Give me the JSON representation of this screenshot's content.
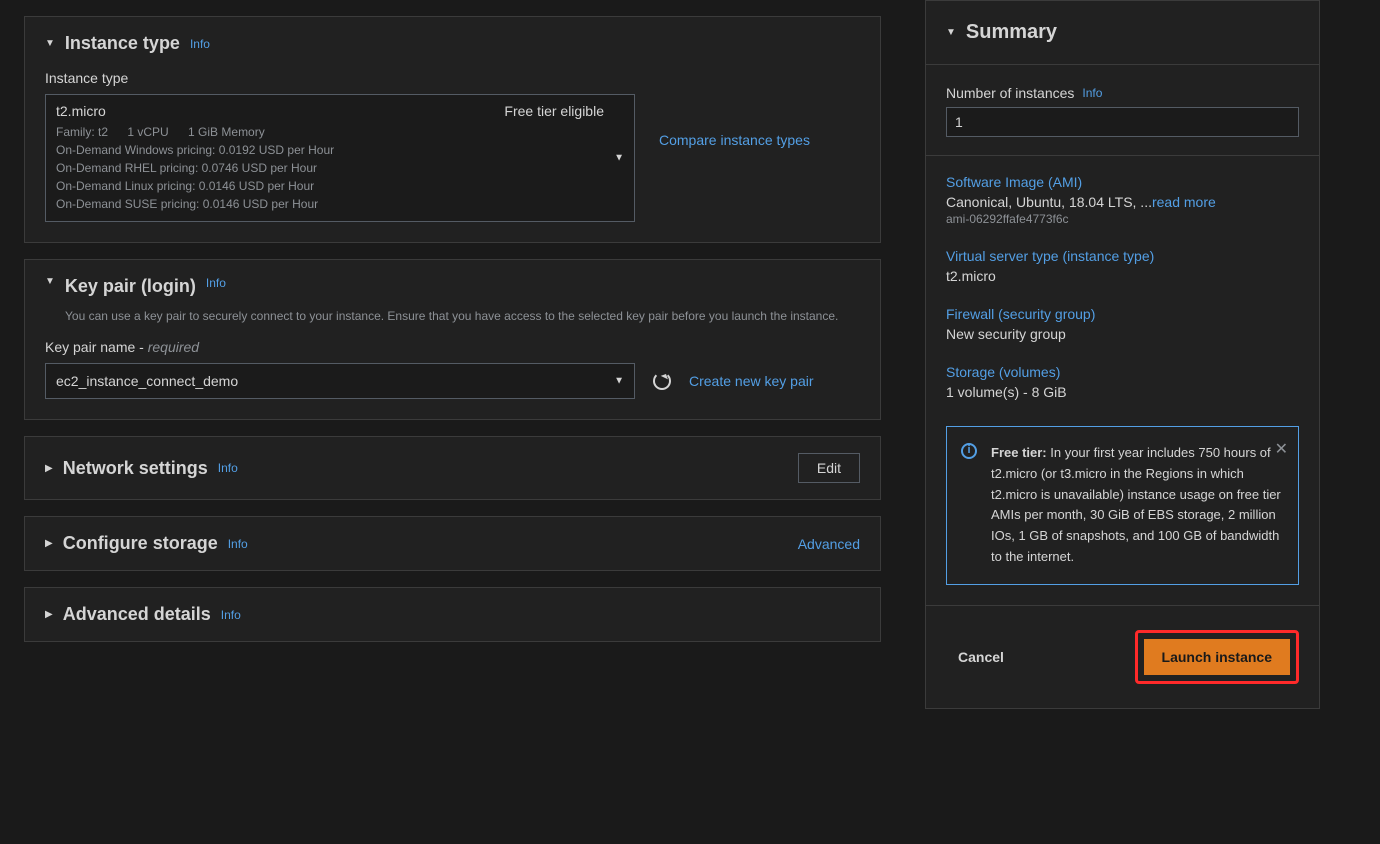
{
  "info_label": "Info",
  "instance_type": {
    "section_title": "Instance type",
    "field_label": "Instance type",
    "selected_name": "t2.micro",
    "free_tier_badge": "Free tier eligible",
    "family": "Family: t2",
    "vcpu": "1 vCPU",
    "memory": "1 GiB Memory",
    "pricing_windows": "On-Demand Windows pricing: 0.0192 USD per Hour",
    "pricing_rhel": "On-Demand RHEL pricing: 0.0746 USD per Hour",
    "pricing_linux": "On-Demand Linux pricing: 0.0146 USD per Hour",
    "pricing_suse": "On-Demand SUSE pricing: 0.0146 USD per Hour",
    "compare_link": "Compare instance types"
  },
  "key_pair": {
    "section_title": "Key pair (login)",
    "description": "You can use a key pair to securely connect to your instance. Ensure that you have access to the selected key pair before you launch the instance.",
    "field_label_prefix": "Key pair name - ",
    "field_label_req": "required",
    "selected": "ec2_instance_connect_demo",
    "create_link": "Create new key pair"
  },
  "network": {
    "section_title": "Network settings",
    "edit_button": "Edit"
  },
  "storage": {
    "section_title": "Configure storage",
    "advanced_link": "Advanced"
  },
  "advanced": {
    "section_title": "Advanced details"
  },
  "summary": {
    "title": "Summary",
    "num_instances_label": "Number of instances",
    "num_instances_value": "1",
    "ami": {
      "title": "Software Image (AMI)",
      "value": "Canonical, Ubuntu, 18.04 LTS, ...",
      "read_more": "read more",
      "id": "ami-06292ffafe4773f6c"
    },
    "server_type": {
      "title": "Virtual server type (instance type)",
      "value": "t2.micro"
    },
    "firewall": {
      "title": "Firewall (security group)",
      "value": "New security group"
    },
    "storage": {
      "title": "Storage (volumes)",
      "value": "1 volume(s) - 8 GiB"
    },
    "free_tier_label": "Free tier:",
    "free_tier_text": " In your first year includes 750 hours of t2.micro (or t3.micro in the Regions in which t2.micro is unavailable) instance usage on free tier AMIs per month, 30 GiB of EBS storage, 2 million IOs, 1 GB of snapshots, and 100 GB of bandwidth to the internet.",
    "cancel": "Cancel",
    "launch": "Launch instance"
  }
}
